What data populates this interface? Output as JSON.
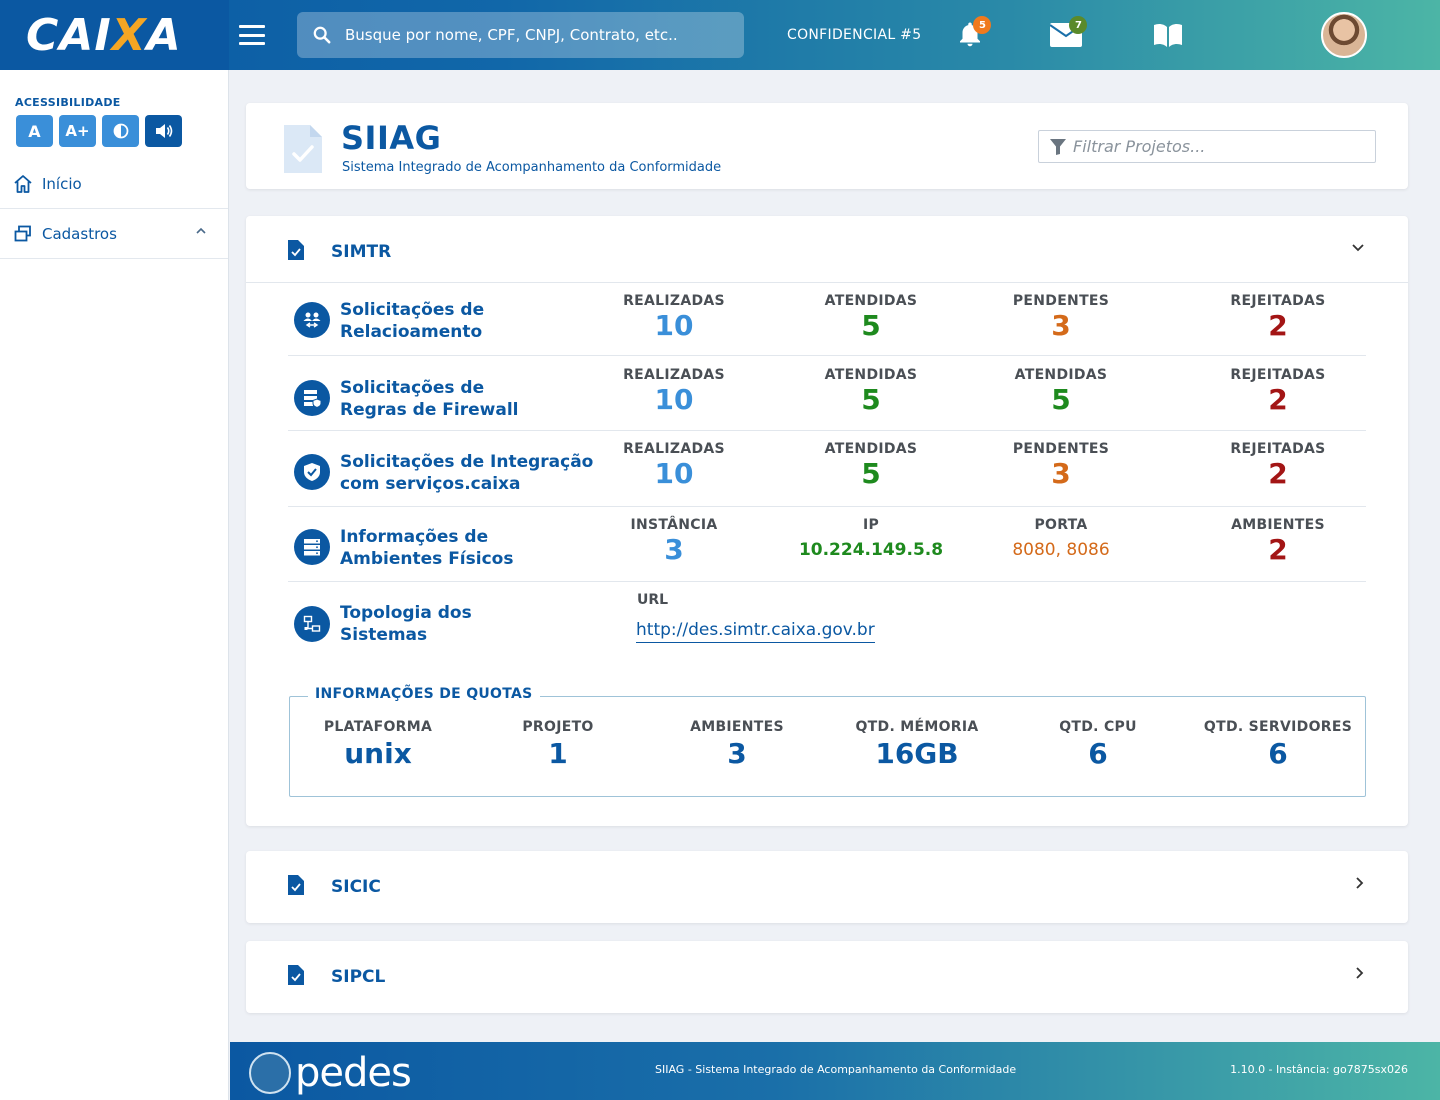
{
  "header": {
    "logo_text": "CAIXA",
    "search_placeholder": "Busque por nome, CPF, CNPJ, Contrato, etc..",
    "confidencial": "CONFIDENCIAL #5",
    "notifications_count": "5",
    "messages_count": "7",
    "badge_notifications_color": "#f07a1e",
    "badge_messages_color": "#5a8a2a"
  },
  "sidebar": {
    "accessibility_title": "ACESSIBILIDADE",
    "acc_buttons": [
      "A",
      "A+"
    ],
    "items": [
      {
        "label": "Início",
        "icon": "home-icon"
      },
      {
        "label": "Cadastros",
        "icon": "windows-icon"
      }
    ]
  },
  "page": {
    "title": "SIIAG",
    "subtitle": "Sistema Integrado de Acompanhamento da Conformidade",
    "filter_placeholder": "Filtrar Projetos..."
  },
  "simtr": {
    "name": "SIMTR",
    "rows": [
      {
        "label_line1": "Solicitações de",
        "label_line2": "Relacioamento",
        "stats": [
          {
            "label": "REALIZADAS",
            "value": "10"
          },
          {
            "label": "ATENDIDAS",
            "value": "5"
          },
          {
            "label": "PENDENTES",
            "value": "3"
          },
          {
            "label": "REJEITADAS",
            "value": "2"
          }
        ]
      },
      {
        "label_line1": "Solicitações de",
        "label_line2": "Regras de Firewall",
        "stats": [
          {
            "label": "REALIZADAS",
            "value": "10"
          },
          {
            "label": "ATENDIDAS",
            "value": "5"
          },
          {
            "label": "ATENDIDAS",
            "value": "5"
          },
          {
            "label": "REJEITADAS",
            "value": "2"
          }
        ]
      },
      {
        "label_line1": "Solicitações de Integração",
        "label_line2": "com serviços.caixa",
        "stats": [
          {
            "label": "REALIZADAS",
            "value": "10"
          },
          {
            "label": "ATENDIDAS",
            "value": "5"
          },
          {
            "label": "PENDENTES",
            "value": "3"
          },
          {
            "label": "REJEITADAS",
            "value": "2"
          }
        ]
      },
      {
        "label_line1": "Informações de",
        "label_line2": "Ambientes Físicos",
        "stats": [
          {
            "label": "INSTÂNCIA",
            "value": "3"
          },
          {
            "label": "IP",
            "value": "10.224.149.5.8"
          },
          {
            "label": "PORTA",
            "value": "8080, 8086"
          },
          {
            "label": "AMBIENTES",
            "value": "2"
          }
        ]
      },
      {
        "label_line1": "Topologia dos",
        "label_line2": "Sistemas",
        "url_label": "URL",
        "url": "http://des.simtr.caixa.gov.br"
      }
    ],
    "quota": {
      "title": "INFORMAÇÕES DE QUOTAS",
      "items": [
        {
          "label": "PLATAFORMA",
          "value": "unix"
        },
        {
          "label": "PROJETO",
          "value": "1"
        },
        {
          "label": "AMBIENTES",
          "value": "3"
        },
        {
          "label": "QTD. MÉMORIA",
          "value": "16GB"
        },
        {
          "label": "QTD. CPU",
          "value": "6"
        },
        {
          "label": "QTD. SERVIDORES",
          "value": "6"
        }
      ]
    }
  },
  "sections": [
    {
      "name": "SICIC"
    },
    {
      "name": "SIPCL"
    }
  ],
  "footer": {
    "logo_text": "pedes",
    "center": "SIIAG  - Sistema Integrado de Acompanhamento da Conformidade",
    "version": "1.10.0 - Instância: go7875sx026"
  },
  "colors": {
    "primary": "#0b58a2",
    "blue": "#3a8fd9",
    "green": "#1e8a1e",
    "orange": "#d46a1a",
    "red": "#a31515"
  }
}
